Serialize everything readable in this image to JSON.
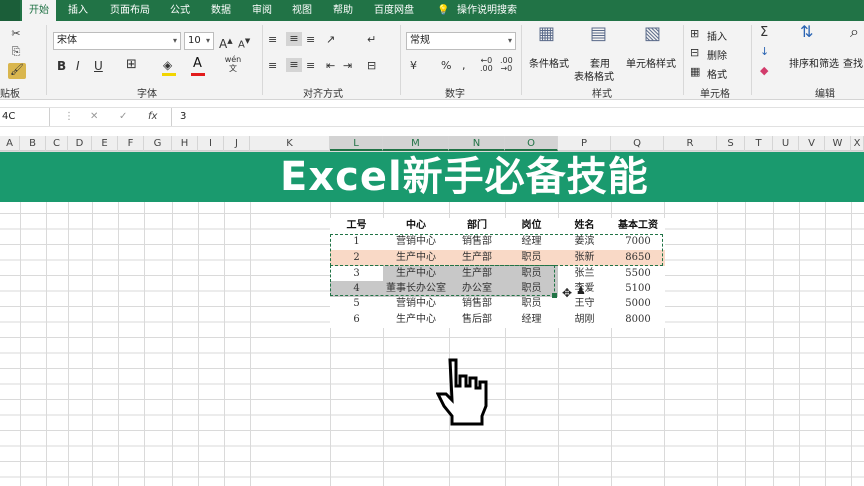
{
  "tabs": [
    "开始",
    "插入",
    "页面布局",
    "公式",
    "数据",
    "审阅",
    "视图",
    "帮助",
    "百度网盘",
    "操作说明搜索"
  ],
  "ribbon": {
    "font_name": "宋体",
    "font_size": "10",
    "number_format": "常规",
    "groups": [
      "贴板",
      "字体",
      "对齐方式",
      "数字",
      "样式",
      "单元格",
      "编辑"
    ],
    "styles": {
      "conditional": "条件格式",
      "table": "套用",
      "table2": "表格格式",
      "cell": "单元格样式"
    },
    "cells": {
      "insert": "插入",
      "delete": "删除",
      "format": "格式"
    },
    "edit": {
      "sort": "排序和筛选",
      "find": "查找"
    },
    "font_buttons": {
      "bold": "B",
      "italic": "I",
      "underline": "U",
      "grow": "A",
      "shrink": "A",
      "wen": "wén 文"
    }
  },
  "formula_bar": {
    "name_box": "4C",
    "fx": "fx",
    "value": "3",
    "cancel": "✕",
    "confirm": "✓"
  },
  "columns": [
    "A",
    "B",
    "C",
    "D",
    "E",
    "F",
    "G",
    "H",
    "I",
    "J",
    "K",
    "L",
    "M",
    "N",
    "O",
    "P",
    "Q",
    "R",
    "S",
    "T",
    "U",
    "V",
    "W",
    "X"
  ],
  "banner": "Excel新手必备技能",
  "table": {
    "headers": [
      "工号",
      "中心",
      "部门",
      "岗位",
      "姓名",
      "基本工资"
    ],
    "rows": [
      [
        "1",
        "营销中心",
        "销售部",
        "经理",
        "姜滨",
        "7000"
      ],
      [
        "2",
        "生产中心",
        "生产部",
        "职员",
        "张新",
        "8650"
      ],
      [
        "3",
        "生产中心",
        "生产部",
        "职员",
        "张兰",
        "5500"
      ],
      [
        "4",
        "董事长办公室",
        "办公室",
        "职员",
        "李爱",
        "5100"
      ],
      [
        "5",
        "营销中心",
        "销售部",
        "职员",
        "王守",
        "5000"
      ],
      [
        "6",
        "生产中心",
        "售后部",
        "经理",
        "胡刚",
        "8000"
      ]
    ]
  },
  "colors": {
    "excel_green": "#217346",
    "banner": "#1a9a6e",
    "pink": "#f9d9c6",
    "gray": "#c8c8c8"
  }
}
